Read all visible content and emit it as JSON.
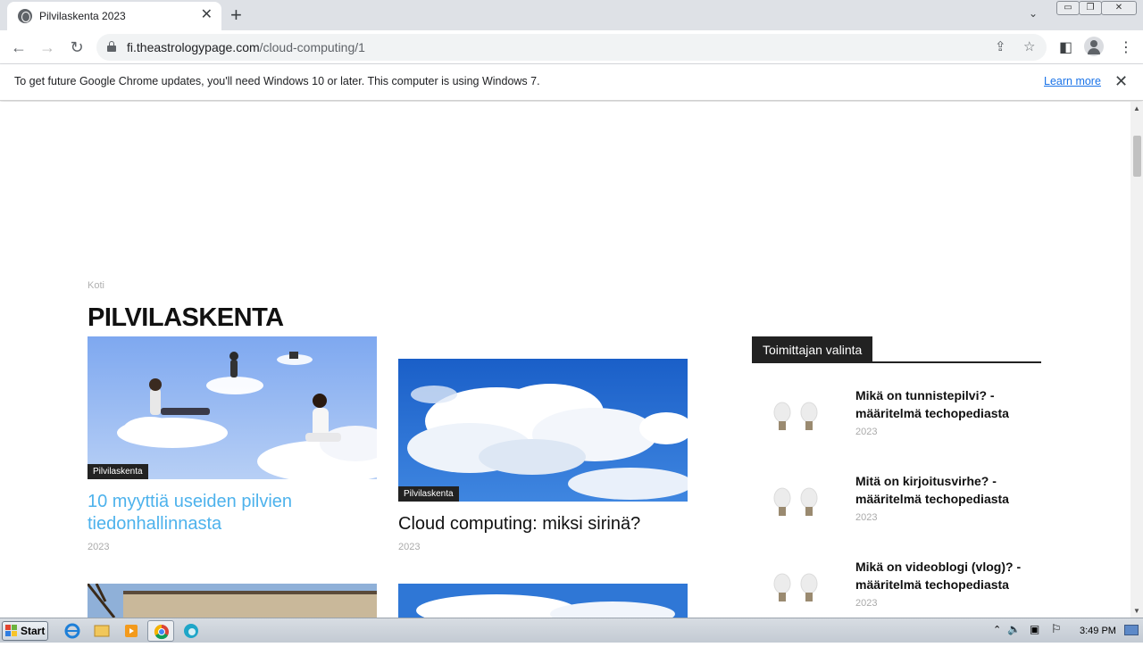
{
  "browser": {
    "tab_title": "Pilvilaskenta 2023",
    "url_domain": "fi.theastrologypage.com",
    "url_path": "/cloud-computing/1"
  },
  "infobar": {
    "message": "To get future Google Chrome updates, you'll need Windows 10 or later. This computer is using Windows 7.",
    "learn_more": "Learn more"
  },
  "page": {
    "breadcrumb": "Koti",
    "heading": "PILVILASKENTA",
    "articles": [
      {
        "category": "Pilvilaskenta",
        "title": "10 myyttiä useiden pilvien tiedonhallinnasta",
        "year": "2023"
      },
      {
        "category": "Pilvilaskenta",
        "title": "Cloud computing: miksi sirinä?",
        "year": "2023"
      }
    ],
    "sidebar": {
      "heading": "Toimittajan valinta",
      "items": [
        {
          "title": "Mikä on tunnistepilvi? - määritelmä techopediasta",
          "year": "2023"
        },
        {
          "title": "Mitä on kirjoitusvirhe? - määritelmä techopediasta",
          "year": "2023"
        },
        {
          "title": "Mikä on videoblogi (vlog)? - määritelmä techopediasta",
          "year": "2023"
        }
      ]
    }
  },
  "taskbar": {
    "start_label": "Start",
    "time": "3:49 PM"
  },
  "colors": {
    "accent_link": "#4db2ec",
    "chrome_blue": "#1a73e8"
  }
}
